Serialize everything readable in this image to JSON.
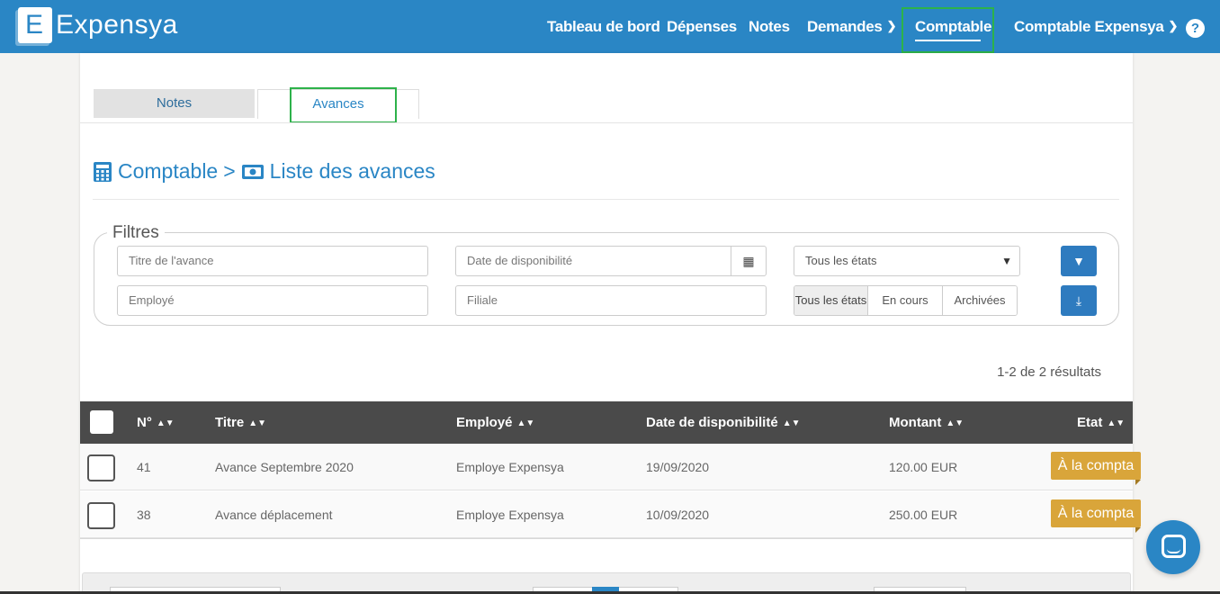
{
  "brand": {
    "logo_letter": "E",
    "name": "Expensya"
  },
  "nav": {
    "items": [
      {
        "label": "Tableau de bord"
      },
      {
        "label": "Dépenses"
      },
      {
        "label": "Notes"
      },
      {
        "label": "Demandes"
      },
      {
        "label": "Comptable"
      },
      {
        "label": "Comptable Expensya"
      }
    ],
    "active": "Comptable",
    "help": "?"
  },
  "tabs": [
    {
      "label": "Notes",
      "active": false
    },
    {
      "label": "Avances",
      "active": true
    }
  ],
  "breadcrumb": {
    "section": "Comptable",
    "separator": ">",
    "page": "Liste des avances"
  },
  "filters": {
    "legend": "Filtres",
    "title_placeholder": "Titre de l'avance",
    "date_placeholder": "Date de disponibilité",
    "state_select": "Tous les états",
    "employee_placeholder": "Employé",
    "subsidiary_placeholder": "Filiale",
    "state_segments": [
      "Tous les états",
      "En cours",
      "Archivées"
    ],
    "active_segment": "Tous les états"
  },
  "results_text": "1-2 de 2 résultats",
  "table": {
    "columns": [
      "N°",
      "Titre",
      "Employé",
      "Date de disponibilité",
      "Montant",
      "Etat"
    ],
    "rows": [
      {
        "no": "41",
        "title": "Avance Septembre 2020",
        "employee": "Employe Expensya",
        "date": "19/09/2020",
        "amount": "120.00 EUR",
        "state": "À la compta"
      },
      {
        "no": "38",
        "title": "Avance déplacement",
        "employee": "Employe Expensya",
        "date": "10/09/2020",
        "amount": "250.00 EUR",
        "state": "À la compta"
      }
    ]
  },
  "colors": {
    "primary": "#2a86c5",
    "highlight": "#2db24a",
    "badge": "#d9a53a",
    "table_header": "#4a4a4a"
  }
}
